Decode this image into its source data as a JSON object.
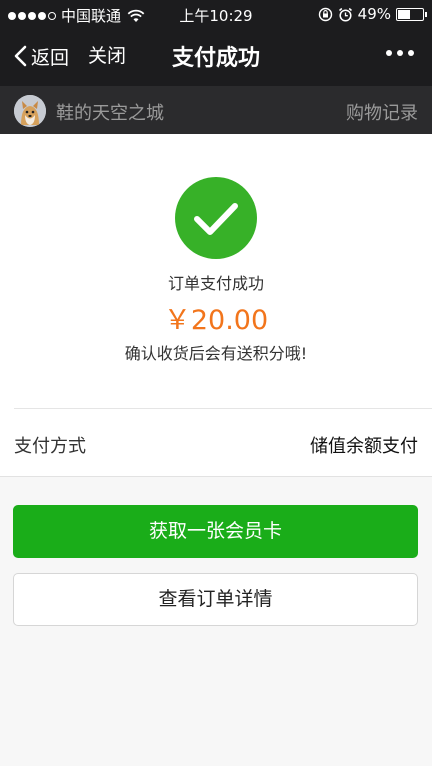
{
  "status_bar": {
    "signal_dots": 5,
    "signal_filled": 4,
    "carrier": "中国联通",
    "time": "上午10:29",
    "battery": "49%",
    "battery_level": 0.49
  },
  "nav": {
    "back_label": "返回",
    "close_label": "关闭",
    "title": "支付成功"
  },
  "shop_bar": {
    "shop_name": "鞋的天空之城",
    "record_label": "购物记录"
  },
  "result": {
    "status_text": "订单支付成功",
    "amount": "￥20.00",
    "note": "确认收货后会有送积分哦!"
  },
  "payment": {
    "method_label": "支付方式",
    "method_value": "储值余额支付"
  },
  "actions": {
    "primary_label": "获取一张会员卡",
    "secondary_label": "查看订单详情"
  },
  "colors": {
    "success_green": "#37b128",
    "button_green": "#1aad19",
    "amount_orange": "#f2751c",
    "header_dark": "#1c1c1e"
  }
}
